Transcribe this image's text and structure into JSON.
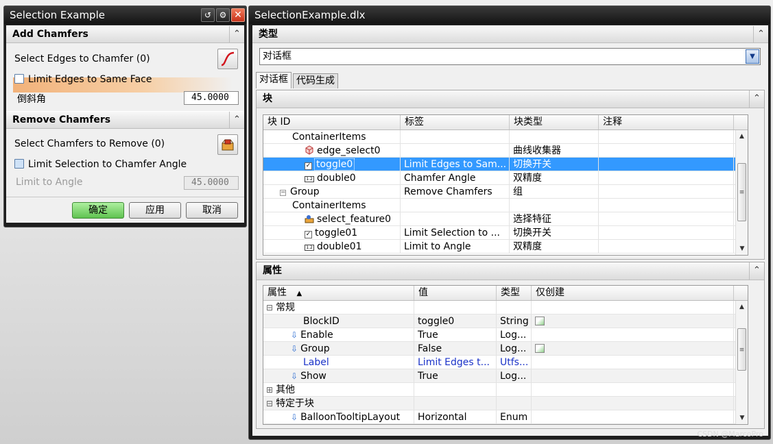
{
  "left_dialog": {
    "title": "Selection Example",
    "title_buttons": [
      "reset",
      "settings",
      "close"
    ],
    "add_group": {
      "header": "Add Chamfers",
      "select_edges_label": "Select Edges to Chamfer (0)",
      "limit_edges_label": "Limit Edges to Same Face",
      "chamfer_angle_label": "倒斜角",
      "chamfer_angle_value": "45.0000"
    },
    "remove_group": {
      "header": "Remove Chamfers",
      "select_chamfers_label": "Select Chamfers to Remove  (0)",
      "limit_selection_label": "Limit Selection to Chamfer Angle",
      "limit_angle_label": "Limit to Angle",
      "limit_angle_value": "45.0000"
    },
    "buttons": {
      "ok": "确定",
      "apply": "应用",
      "cancel": "取消"
    }
  },
  "right_window": {
    "title": "SelectionExample.dlx",
    "type_section": {
      "header": "类型",
      "selected": "对话框"
    },
    "tabs": [
      "对话框",
      "代码生成"
    ],
    "block_section": {
      "header": "块",
      "columns": [
        "块 ID",
        "标签",
        "块类型",
        "注释"
      ],
      "rows": [
        {
          "indent": 2,
          "icon": "none",
          "id": "ContainerItems",
          "label": "",
          "type": "",
          "note": ""
        },
        {
          "indent": 3,
          "icon": "cube-icon",
          "id": "edge_select0",
          "label": "",
          "type": "曲线收集器",
          "note": ""
        },
        {
          "indent": 3,
          "icon": "checkbox-icon",
          "id": "toggle0",
          "label": "Limit Edges to Sam...",
          "type": "切换开关",
          "note": "",
          "selected": true
        },
        {
          "indent": 3,
          "icon": "double-icon",
          "id": "double0",
          "label": "Chamfer Angle",
          "type": "双精度",
          "note": ""
        },
        {
          "indent": 1,
          "icon": "minus",
          "id": "Group",
          "label": "Remove Chamfers",
          "type": "组",
          "note": ""
        },
        {
          "indent": 2,
          "icon": "none",
          "id": "ContainerItems",
          "label": "",
          "type": "",
          "note": ""
        },
        {
          "indent": 3,
          "icon": "feature-icon",
          "id": "select_feature0",
          "label": "",
          "type": "选择特征",
          "note": ""
        },
        {
          "indent": 3,
          "icon": "checkbox-icon",
          "id": "toggle01",
          "label": "Limit Selection to ...",
          "type": "切换开关",
          "note": ""
        },
        {
          "indent": 3,
          "icon": "double-icon",
          "id": "double01",
          "label": "Limit to Angle",
          "type": "双精度",
          "note": ""
        }
      ]
    },
    "property_section": {
      "header": "属性",
      "columns": [
        "属性",
        "值",
        "类型",
        "仅创建"
      ],
      "rows": [
        {
          "kind": "group",
          "sign": "⊟",
          "name": "常规",
          "value": "",
          "type": "",
          "create_only": false
        },
        {
          "kind": "prop",
          "arrow": false,
          "name": "BlockID",
          "value": "toggle0",
          "type": "String",
          "create_only": true
        },
        {
          "kind": "prop",
          "arrow": true,
          "name": "Enable",
          "value": "True",
          "type": "Log...",
          "create_only": false
        },
        {
          "kind": "prop",
          "arrow": true,
          "name": "Group",
          "value": "False",
          "type": "Log...",
          "create_only": true
        },
        {
          "kind": "prop",
          "arrow": false,
          "name": "Label",
          "value": "Limit Edges t...",
          "type": "Utfs...",
          "create_only": false,
          "highlight": true
        },
        {
          "kind": "prop",
          "arrow": true,
          "name": "Show",
          "value": "True",
          "type": "Log...",
          "create_only": false
        },
        {
          "kind": "group",
          "sign": "⊞",
          "name": "其他",
          "value": "",
          "type": "",
          "create_only": false
        },
        {
          "kind": "group",
          "sign": "⊟",
          "name": "特定于块",
          "value": "",
          "type": "",
          "create_only": false
        },
        {
          "kind": "prop",
          "arrow": true,
          "name": "BalloonTooltipLayout",
          "value": "Horizontal",
          "type": "Enum",
          "create_only": false
        }
      ]
    }
  },
  "watermark": "CSDN @MarcoPro"
}
